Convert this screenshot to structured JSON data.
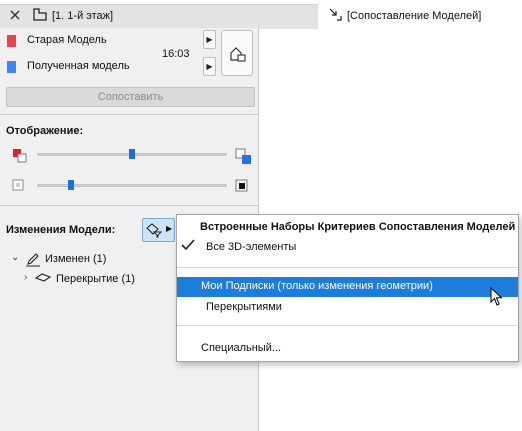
{
  "tabs": {
    "active_label": "[1. 1-й этаж]",
    "secondary_label": "[Сопоставление Моделей]"
  },
  "models": {
    "old_label": "Старая Модель",
    "received_label": "Полученная модель",
    "time": "16:03",
    "old_color": "#e8434a",
    "received_color": "#3b86f0"
  },
  "compare_button": "Сопоставить",
  "display": {
    "title": "Отображение:",
    "slider1_value": 0.5,
    "slider2_value": 0.18
  },
  "changes": {
    "title": "Изменения Модели:",
    "tree": [
      {
        "label": "Изменен (1)",
        "level": 0,
        "expanded": true
      },
      {
        "label": "Перекрытие (1)",
        "level": 1,
        "expanded": false
      }
    ]
  },
  "menu": {
    "header": "Встроенные Наборы Критериев Сопоставления Моделей",
    "items": [
      {
        "label": "Все 3D-элементы",
        "checked": true
      },
      {
        "label": "Мои Подписки (только изменения геометрии)",
        "highlighted": true
      },
      {
        "label": "Перекрытиями"
      },
      {
        "label": "Специальный..."
      }
    ]
  }
}
